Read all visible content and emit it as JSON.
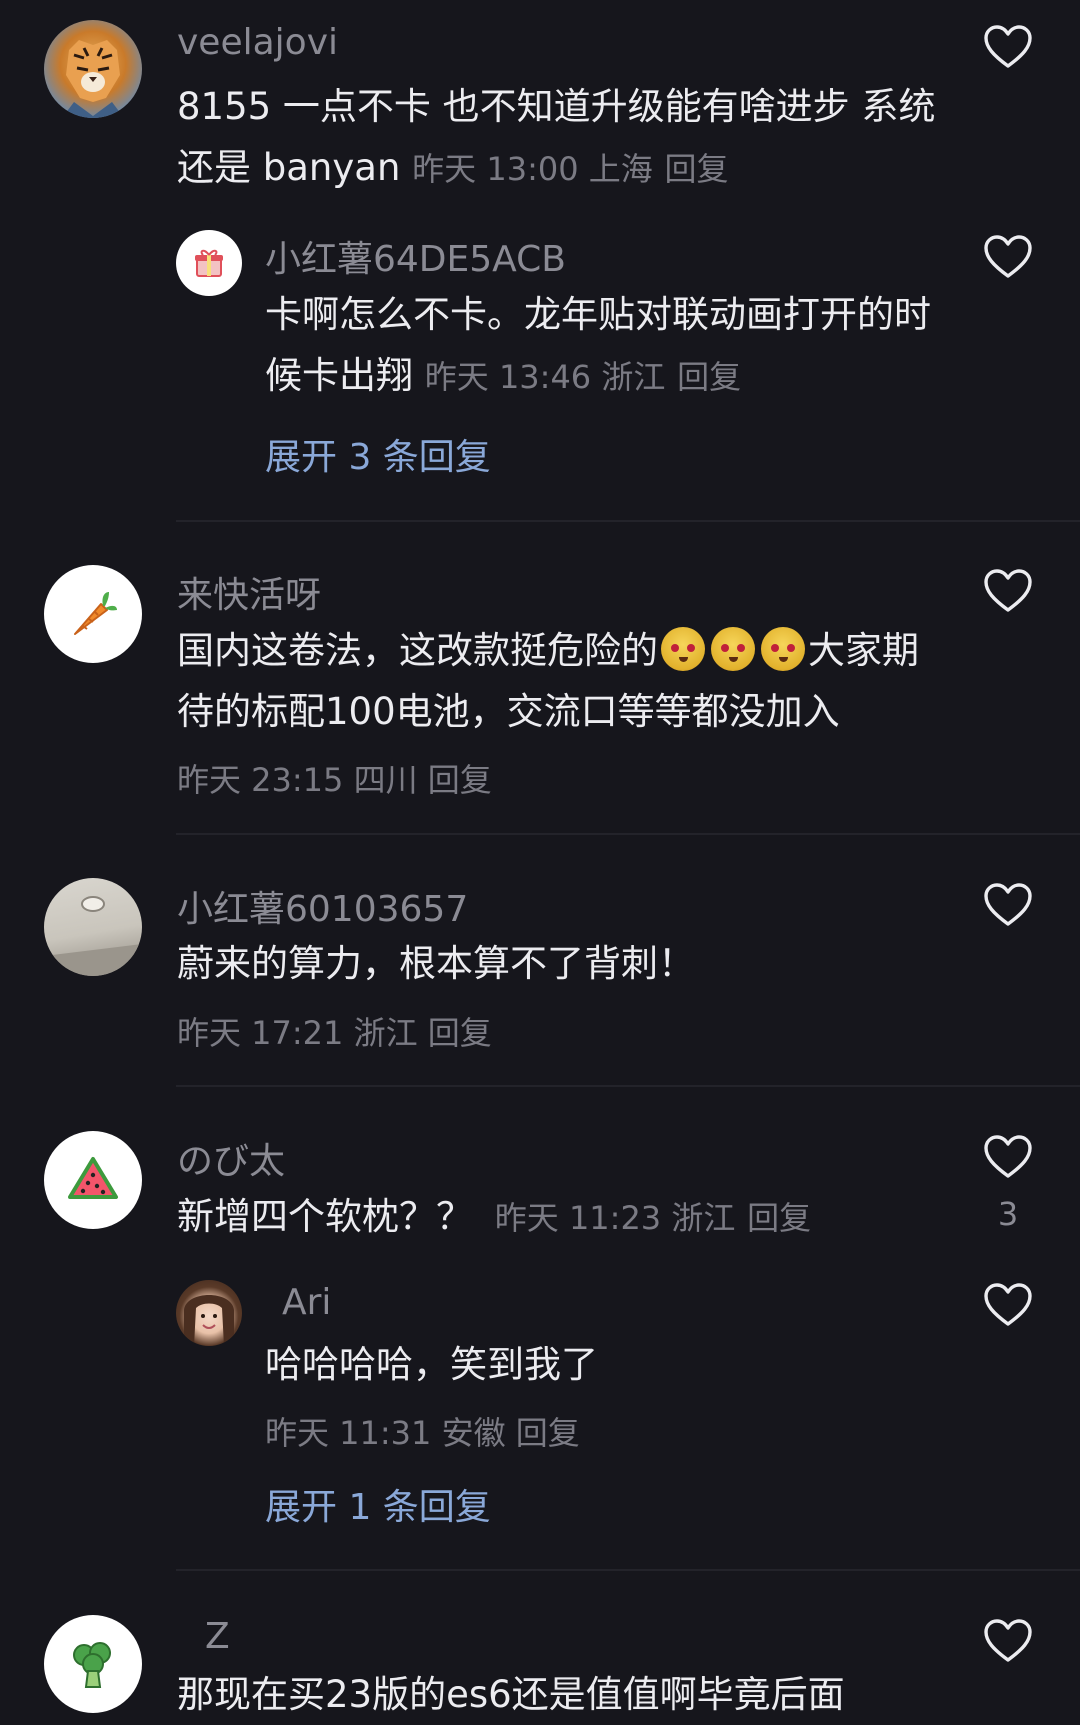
{
  "comments": [
    {
      "username": "veelajovi",
      "text": "8155 一点不卡 也不知道升级能有啥进步 系统还是 banyan",
      "meta": "昨天 13:00 上海",
      "reply": "回复",
      "avatar": "tiger-avatar",
      "replies": [
        {
          "username": "小红薯64DE5ACB",
          "text": "卡啊怎么不卡。龙年贴对联动画打开的时候卡出翔",
          "meta": "昨天 13:46 浙江",
          "reply": "回复",
          "avatar": "gift-icon"
        }
      ],
      "expand": "展开 3 条回复"
    },
    {
      "username": "来快活呀",
      "text_part1": "国内这卷法，这改款挺危险的",
      "text_part2": "大家期待的标配100电池，交流口等等都没加入",
      "meta": "昨天 23:15 四川",
      "reply": "回复",
      "avatar": "carrot-icon",
      "emoji": "face-emoji"
    },
    {
      "username": "小红薯60103657",
      "text": "蔚来的算力，根本算不了背刺！",
      "meta": "昨天 17:21 浙江",
      "reply": "回复",
      "avatar": "ceiling-photo"
    },
    {
      "username": "のび太",
      "text": "新增四个软枕？？",
      "meta": "昨天 11:23 浙江",
      "reply": "回复",
      "likes": "3",
      "avatar": "watermelon-icon",
      "replies": [
        {
          "username": "Ari",
          "text": "哈哈哈哈，笑到我了",
          "meta": "昨天 11:31 安徽",
          "reply": "回复",
          "avatar": "girl-photo"
        }
      ],
      "expand": "展开 1 条回复"
    },
    {
      "username": "Z",
      "text": "那现在买23版的es6还是值值啊毕竟后面",
      "avatar": "broccoli-icon"
    }
  ],
  "colors": {
    "background": "#16161c",
    "link": "#8aa8d8",
    "meta": "#7b7b84"
  }
}
